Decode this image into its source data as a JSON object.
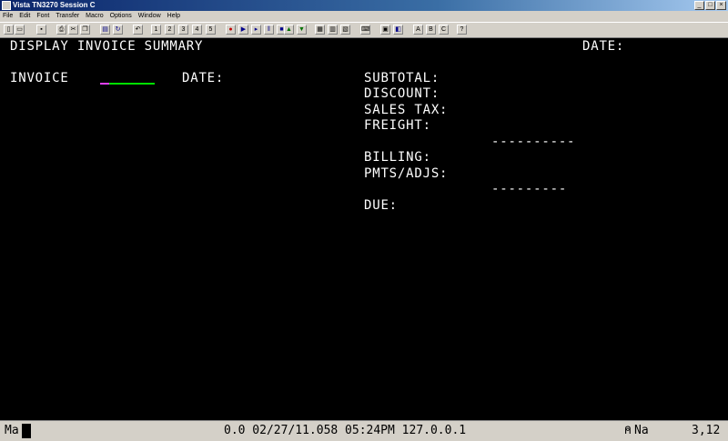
{
  "window": {
    "title": "Vista TN3270 Session C",
    "controls": [
      "_",
      "□",
      "×"
    ]
  },
  "menu": [
    "File",
    "Edit",
    "Font",
    "Transfer",
    "Macro",
    "Options",
    "Window",
    "Help"
  ],
  "toolbar": {
    "buttons": [
      {
        "name": "new-icon",
        "glyph": "▯"
      },
      {
        "name": "open-icon",
        "glyph": "▭"
      },
      {
        "name": "save-icon",
        "glyph": "▪"
      },
      {
        "name": "print-icon",
        "glyph": "⎙"
      },
      {
        "name": "cut-icon",
        "glyph": "✂"
      },
      {
        "name": "copy-icon",
        "glyph": "❐"
      },
      {
        "name": "paste-icon",
        "glyph": "▤"
      },
      {
        "name": "connect-icon",
        "glyph": "↻"
      },
      {
        "name": "disconnect-icon",
        "glyph": "↺"
      },
      {
        "name": "undo-icon",
        "glyph": "↶"
      },
      {
        "name": "macro-1-icon",
        "glyph": "1"
      },
      {
        "name": "macro-2-icon",
        "glyph": "2"
      },
      {
        "name": "macro-3-icon",
        "glyph": "3"
      },
      {
        "name": "macro-4-icon",
        "glyph": "4"
      },
      {
        "name": "macro-5-icon",
        "glyph": "5"
      },
      {
        "name": "record-icon",
        "glyph": "●"
      },
      {
        "name": "play-icon",
        "glyph": "▶"
      },
      {
        "name": "step-icon",
        "glyph": "▸"
      },
      {
        "name": "pause-icon",
        "glyph": "‖"
      },
      {
        "name": "stop-icon",
        "glyph": "■"
      },
      {
        "name": "upload-icon",
        "glyph": "▲"
      },
      {
        "name": "download-icon",
        "glyph": "▼"
      },
      {
        "name": "screen-1-icon",
        "glyph": "▦"
      },
      {
        "name": "screen-2-icon",
        "glyph": "▥"
      },
      {
        "name": "screen-3-icon",
        "glyph": "▧"
      },
      {
        "name": "keyboard-icon",
        "glyph": "⌨"
      },
      {
        "name": "session-1-icon",
        "glyph": "▣"
      },
      {
        "name": "session-2-icon",
        "glyph": "◧"
      },
      {
        "name": "font-a-icon",
        "glyph": "A"
      },
      {
        "name": "font-b-icon",
        "glyph": "B"
      },
      {
        "name": "font-c-icon",
        "glyph": "C"
      },
      {
        "name": "help-icon",
        "glyph": "?"
      }
    ]
  },
  "screen": {
    "title": "DISPLAY INVOICE SUMMARY",
    "date_label_top": "DATE:",
    "invoice_label": "INVOICE",
    "date_label": "DATE:",
    "subtotal_label": "SUBTOTAL:",
    "discount_label": "DISCOUNT:",
    "sales_tax_label": "SALES TAX:",
    "freight_label": "FREIGHT:",
    "rule_1": "----------",
    "billing_label": "BILLING:",
    "pmts_label": "PMTS/ADJS:",
    "rule_2": "---------",
    "due_label": "DUE:"
  },
  "status": {
    "mode": "Ma",
    "info": "0.0 02/27/11.058 05:24PM 127.0.0.1",
    "indicator": "Na",
    "cursor_pos": "3,12"
  },
  "colors": {
    "terminal_bg": "#000000",
    "terminal_text": "#ffffff",
    "field_underline": "#00e000",
    "field_cursor": "#e040ff"
  }
}
